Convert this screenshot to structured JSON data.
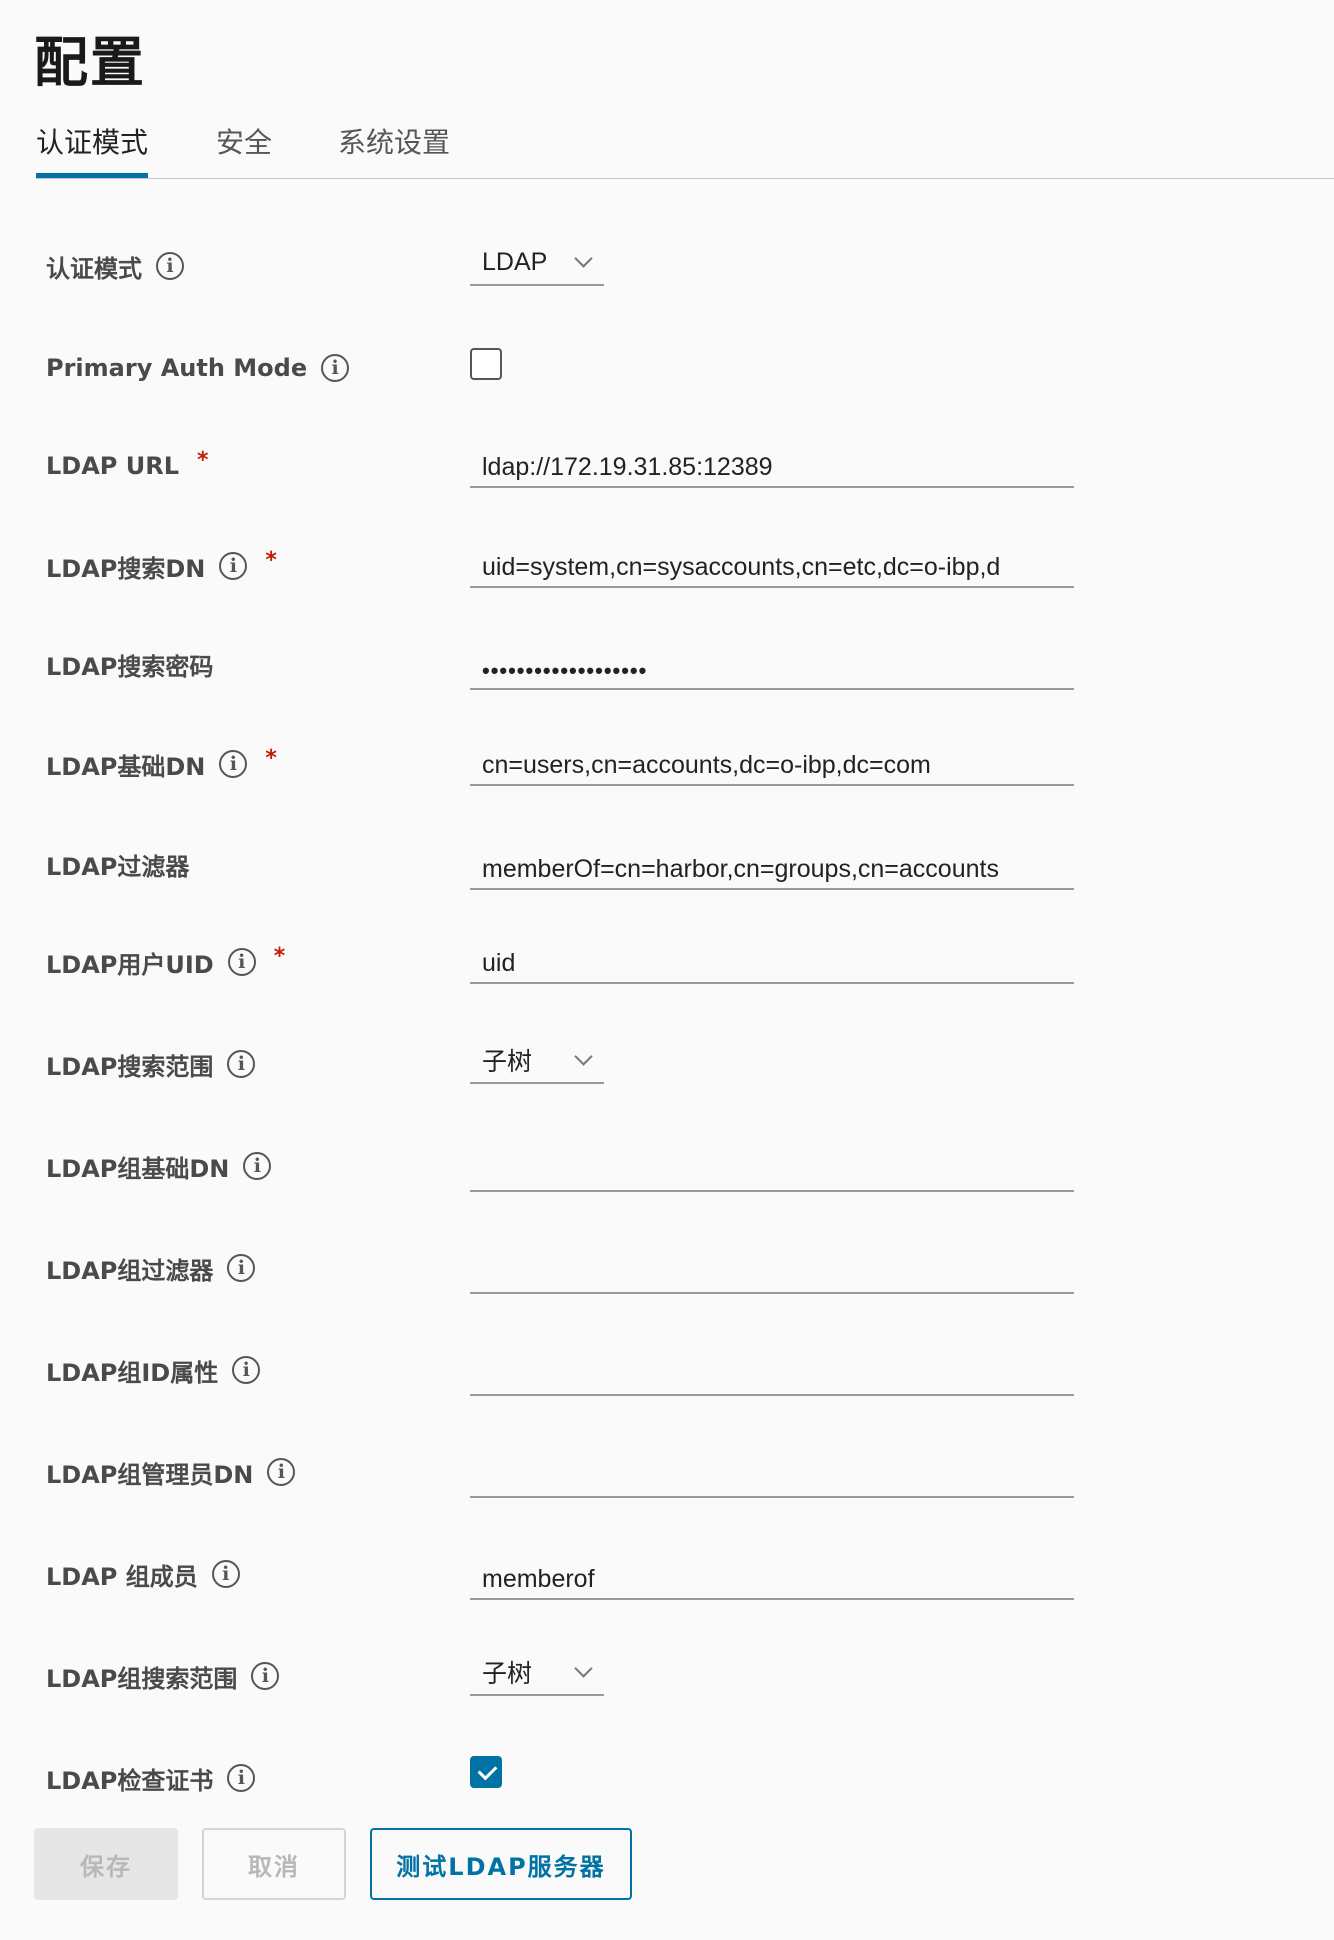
{
  "page_title": "配置",
  "tabs": [
    {
      "label": "认证模式",
      "active": true
    },
    {
      "label": "安全",
      "active": false
    },
    {
      "label": "系统设置",
      "active": false
    }
  ],
  "form": {
    "auth_mode": {
      "label": "认证模式",
      "value": "LDAP"
    },
    "primary_auth_mode": {
      "label": "Primary Auth Mode",
      "checked": false
    },
    "ldap_url": {
      "label": "LDAP URL",
      "value": "ldap://172.19.31.85:12389",
      "required": true
    },
    "ldap_search_dn": {
      "label": "LDAP搜索DN",
      "value": "uid=system,cn=sysaccounts,cn=etc,dc=o-ibp,d",
      "required": true
    },
    "ldap_search_password": {
      "label": "LDAP搜索密码",
      "value": "•••••••••••••••••••"
    },
    "ldap_base_dn": {
      "label": "LDAP基础DN",
      "value": "cn=users,cn=accounts,dc=o-ibp,dc=com",
      "required": true
    },
    "ldap_filter": {
      "label": "LDAP过滤器",
      "value": "memberOf=cn=harbor,cn=groups,cn=accounts"
    },
    "ldap_uid": {
      "label": "LDAP用户UID",
      "value": "uid",
      "required": true
    },
    "ldap_scope": {
      "label": "LDAP搜索范围",
      "value": "子树"
    },
    "ldap_group_base_dn": {
      "label": "LDAP组基础DN",
      "value": ""
    },
    "ldap_group_filter": {
      "label": "LDAP组过滤器",
      "value": ""
    },
    "ldap_group_gid": {
      "label": "LDAP组ID属性",
      "value": ""
    },
    "ldap_group_admin_dn": {
      "label": "LDAP组管理员DN",
      "value": ""
    },
    "ldap_group_membership": {
      "label": "LDAP 组成员",
      "value": "memberof"
    },
    "ldap_group_scope": {
      "label": "LDAP组搜索范围",
      "value": "子树"
    },
    "ldap_verify_cert": {
      "label": "LDAP检查证书",
      "checked": true
    }
  },
  "required_mark": "*",
  "info_icon_glyph": "i",
  "buttons": {
    "save": "保存",
    "cancel": "取消",
    "test": "测试LDAP服务器"
  },
  "colors": {
    "accent": "#0072a3",
    "required": "#c21d00"
  }
}
